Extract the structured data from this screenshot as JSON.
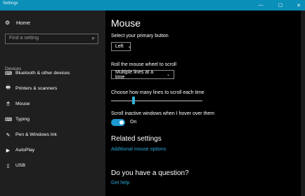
{
  "window": {
    "title": "Settings",
    "minimize_glyph": "—",
    "maximize_glyph": "☐",
    "close_glyph": "✕",
    "accent": "#0a8fb8"
  },
  "sidebar": {
    "home_label": "Home",
    "home_icon": "gear-icon",
    "search_placeholder": "Find a setting",
    "section_label": "Devices",
    "items": [
      {
        "label": "Bluetooth & other devices",
        "icon": "bluetooth-icon",
        "glyph": "⌨"
      },
      {
        "label": "Printers & scanners",
        "icon": "printer-icon",
        "glyph": "🖶"
      },
      {
        "label": "Mouse",
        "icon": "mouse-icon",
        "glyph": "🖱"
      },
      {
        "label": "Typing",
        "icon": "keyboard-icon",
        "glyph": "⌨"
      },
      {
        "label": "Pen & Windows Ink",
        "icon": "pen-icon",
        "glyph": "✎"
      },
      {
        "label": "AutoPlay",
        "icon": "autoplay-icon",
        "glyph": "▶"
      },
      {
        "label": "USB",
        "icon": "usb-icon",
        "glyph": "▯"
      }
    ],
    "active_index": 2
  },
  "main": {
    "title": "Mouse",
    "primary_button_label": "Select your primary button",
    "primary_button_value": "Left",
    "wheel_label": "Roll the mouse wheel to scroll",
    "wheel_value": "Multiple lines at a time",
    "lines_label": "Choose how many lines to scroll each time",
    "inactive_label": "Scroll inactive windows when I hover over them",
    "inactive_toggle": {
      "state": "On",
      "on": true
    },
    "related_title": "Related settings",
    "related_link": "Additional mouse options",
    "question_title": "Do you have a question?",
    "help_link": "Get help",
    "accent_link": "#2fa6d8"
  }
}
